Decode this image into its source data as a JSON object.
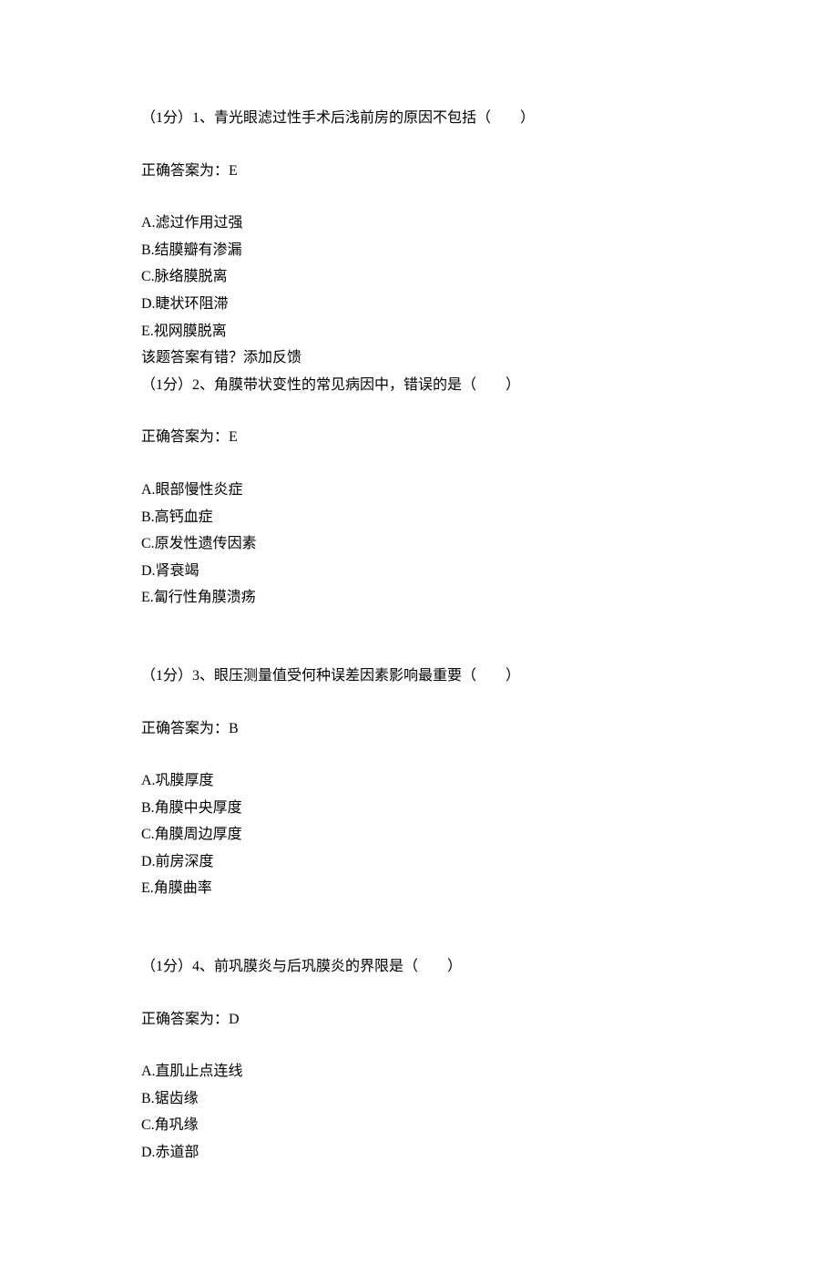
{
  "questions": [
    {
      "header": "（1分）1、青光眼滤过性手术后浅前房的原因不包括（　　）",
      "answer": "正确答案为：E",
      "options": [
        "A.滤过作用过强",
        "B.结膜瓣有渗漏",
        "C.脉络膜脱离",
        "D.睫状环阻滞",
        "E.视网膜脱离"
      ],
      "feedback": "该题答案有错？添加反馈",
      "trailing_spacer": false
    },
    {
      "header": "（1分）2、角膜带状变性的常见病因中，错误的是（　　）",
      "answer": "正确答案为：E",
      "options": [
        "A.眼部慢性炎症",
        "B.高钙血症",
        "C.原发性遗传因素",
        "D.肾衰竭",
        "E.匐行性角膜溃疡"
      ],
      "feedback": "",
      "trailing_spacer": true
    },
    {
      "header": "（1分）3、眼压测量值受何种误差因素影响最重要（　　）",
      "answer": "正确答案为：B",
      "options": [
        "A.巩膜厚度",
        "B.角膜中央厚度",
        "C.角膜周边厚度",
        "D.前房深度",
        "E.角膜曲率"
      ],
      "feedback": "",
      "trailing_spacer": true
    },
    {
      "header": "（1分）4、前巩膜炎与后巩膜炎的界限是（　　）",
      "answer": "正确答案为：D",
      "options": [
        "A.直肌止点连线",
        "B.锯齿缘",
        "C.角巩缘",
        "D.赤道部"
      ],
      "feedback": "",
      "trailing_spacer": false
    }
  ]
}
